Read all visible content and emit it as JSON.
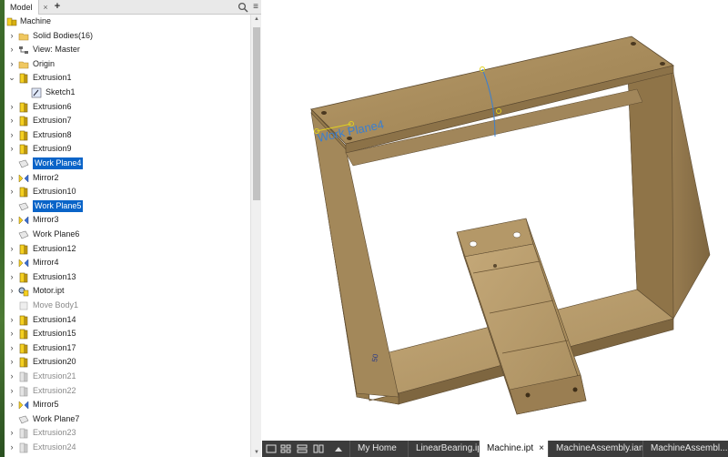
{
  "browser": {
    "tab_label": "Model",
    "tab_close": "×",
    "tab_add": "+",
    "menu_icon": "≡",
    "search_icon": "search-icon"
  },
  "tree": [
    {
      "label": "Machine",
      "level": 0,
      "chev": "",
      "icon": "assembly-root",
      "style": "normal"
    },
    {
      "label": "Solid Bodies(16)",
      "level": 1,
      "chev": "›",
      "icon": "folder",
      "style": "normal"
    },
    {
      "label": "View: Master",
      "level": 1,
      "chev": "›",
      "icon": "view",
      "style": "normal"
    },
    {
      "label": "Origin",
      "level": 1,
      "chev": "›",
      "icon": "folder",
      "style": "normal"
    },
    {
      "label": "Extrusion1",
      "level": 1,
      "chev": "⌄",
      "icon": "extrusion",
      "style": "normal"
    },
    {
      "label": "Sketch1",
      "level": 2,
      "chev": "",
      "icon": "sketch",
      "style": "normal"
    },
    {
      "label": "Extrusion6",
      "level": 1,
      "chev": "›",
      "icon": "extrusion",
      "style": "normal"
    },
    {
      "label": "Extrusion7",
      "level": 1,
      "chev": "›",
      "icon": "extrusion",
      "style": "normal"
    },
    {
      "label": "Extrusion8",
      "level": 1,
      "chev": "›",
      "icon": "extrusion",
      "style": "normal"
    },
    {
      "label": "Extrusion9",
      "level": 1,
      "chev": "›",
      "icon": "extrusion",
      "style": "normal"
    },
    {
      "label": "Work Plane4",
      "level": 1,
      "chev": "",
      "icon": "workplane",
      "style": "selected"
    },
    {
      "label": "Mirror2",
      "level": 1,
      "chev": "›",
      "icon": "mirror",
      "style": "normal"
    },
    {
      "label": "Extrusion10",
      "level": 1,
      "chev": "›",
      "icon": "extrusion",
      "style": "normal"
    },
    {
      "label": "Work Plane5",
      "level": 1,
      "chev": "",
      "icon": "workplane",
      "style": "selected"
    },
    {
      "label": "Mirror3",
      "level": 1,
      "chev": "›",
      "icon": "mirror",
      "style": "normal"
    },
    {
      "label": "Work Plane6",
      "level": 1,
      "chev": "",
      "icon": "workplane",
      "style": "normal"
    },
    {
      "label": "Extrusion12",
      "level": 1,
      "chev": "›",
      "icon": "extrusion",
      "style": "normal"
    },
    {
      "label": "Mirror4",
      "level": 1,
      "chev": "›",
      "icon": "mirror",
      "style": "normal"
    },
    {
      "label": "Extrusion13",
      "level": 1,
      "chev": "›",
      "icon": "extrusion",
      "style": "normal"
    },
    {
      "label": "Motor.ipt",
      "level": 1,
      "chev": "›",
      "icon": "derived",
      "style": "normal"
    },
    {
      "label": "Move Body1",
      "level": 1,
      "chev": "",
      "icon": "move",
      "style": "dim"
    },
    {
      "label": "Extrusion14",
      "level": 1,
      "chev": "›",
      "icon": "extrusion",
      "style": "normal"
    },
    {
      "label": "Extrusion15",
      "level": 1,
      "chev": "›",
      "icon": "extrusion",
      "style": "normal"
    },
    {
      "label": "Extrusion17",
      "level": 1,
      "chev": "›",
      "icon": "extrusion",
      "style": "normal"
    },
    {
      "label": "Extrusion20",
      "level": 1,
      "chev": "›",
      "icon": "extrusion",
      "style": "normal"
    },
    {
      "label": "Extrusion21",
      "level": 1,
      "chev": "›",
      "icon": "extrusion-dim",
      "style": "dim"
    },
    {
      "label": "Extrusion22",
      "level": 1,
      "chev": "›",
      "icon": "extrusion-dim",
      "style": "dim"
    },
    {
      "label": "Mirror5",
      "level": 1,
      "chev": "›",
      "icon": "mirror",
      "style": "normal"
    },
    {
      "label": "Work Plane7",
      "level": 1,
      "chev": "",
      "icon": "workplane",
      "style": "normal"
    },
    {
      "label": "Extrusion23",
      "level": 1,
      "chev": "›",
      "icon": "extrusion-dim",
      "style": "dim"
    },
    {
      "label": "Extrusion24",
      "level": 1,
      "chev": "›",
      "icon": "extrusion-dim",
      "style": "dim"
    }
  ],
  "viewport": {
    "workplane_label": "Work Plane4",
    "dimension_label": "50"
  },
  "docbar": {
    "controls": [
      "tile-icon",
      "cascade-icon",
      "arrange-icon",
      "arrange2-icon",
      "menu-up-icon"
    ],
    "tabs": [
      {
        "label": "My Home",
        "active": false,
        "close": ""
      },
      {
        "label": "LinearBearing.ipt",
        "active": false,
        "close": ""
      },
      {
        "label": "Machine.ipt",
        "active": true,
        "close": "×"
      },
      {
        "label": "MachineAssembly.iam",
        "active": false,
        "close": ""
      },
      {
        "label": "MachineAssembl...ipt",
        "active": false,
        "close": ""
      }
    ]
  },
  "colors": {
    "selection": "#0a64c8",
    "wood": "#a58a5c",
    "workplane_text": "#3a7fd0"
  }
}
